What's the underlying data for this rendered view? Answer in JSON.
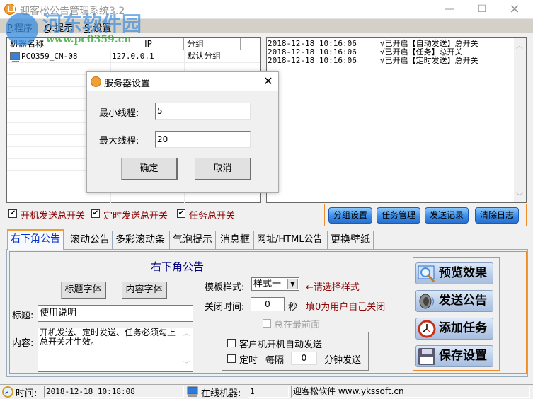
{
  "window": {
    "title": "迎客松公告管理系统3.2",
    "minimize": "—",
    "maximize": "☐",
    "close": "✕"
  },
  "menu": [
    {
      "key": "P",
      "label": ".程序"
    },
    {
      "key": "Q",
      "label": ".提示"
    },
    {
      "key": "S",
      "label": ".设置"
    }
  ],
  "watermark": {
    "text": "河东软件园",
    "url": "www.pc0359.cn"
  },
  "machine_table": {
    "columns": [
      "机器名称",
      "IP",
      "分组",
      ""
    ],
    "rows": [
      {
        "name": "PC0359_CN-08",
        "ip": "127.0.0.1",
        "group": "默认分组",
        "icon": "computer-icon"
      }
    ]
  },
  "log": [
    {
      "time": "2018-12-18 10:16:06",
      "msg": "√已开启【自动发送】总开关"
    },
    {
      "time": "2018-12-18 10:16:06",
      "msg": "√已开启【任务】总开关"
    },
    {
      "time": "2018-12-18 10:16:06",
      "msg": "√已开启【定时发送】总开关"
    }
  ],
  "dialog": {
    "title": "服务器设置",
    "close": "✕",
    "min_label": "最小线程:",
    "min_value": "5",
    "max_label": "最大线程:",
    "max_value": "20",
    "ok": "确定",
    "cancel": "取消"
  },
  "switches": [
    {
      "label": "开机发送总开关",
      "checked": true
    },
    {
      "label": "定时发送总开关",
      "checked": true
    },
    {
      "label": "任务总开关",
      "checked": true
    }
  ],
  "action_buttons": [
    "分组设置",
    "任务管理",
    "发送记录",
    "清除日志"
  ],
  "tabs": [
    {
      "label": "右下角公告",
      "active": true
    },
    {
      "label": "滚动公告"
    },
    {
      "label": "多彩滚动条"
    },
    {
      "label": "气泡提示"
    },
    {
      "label": "消息框"
    },
    {
      "label": "网址/HTML公告"
    },
    {
      "label": "更换壁纸"
    }
  ],
  "panel": {
    "heading": "右下角公告",
    "title_font_btn": "标题字体",
    "content_font_btn": "内容字体",
    "title_label": "标题:",
    "title_value": "使用说明",
    "content_label": "内容:",
    "content_value": "开机发送、定时发送、任务必须勾上总开关才生效。",
    "template_label": "模板样式:",
    "template_value": "样式一",
    "template_hint": "←请选择样式",
    "close_time_label": "关闭时间:",
    "close_time_value": "0",
    "close_time_unit": "秒",
    "close_time_hint": "填0为用户自己关闭",
    "always_top": {
      "label": "总在最前面",
      "checked": false,
      "disabled": true
    },
    "auto_send": {
      "label": "客户机开机自动发送",
      "checked": false
    },
    "timed": {
      "label": "定时",
      "checked": false
    },
    "every_label": "每隔",
    "interval_value": "0",
    "interval_unit": "分钟发送"
  },
  "big_buttons": [
    {
      "label": "预览效果",
      "icon": "magnifier-icon"
    },
    {
      "label": "发送公告",
      "icon": "speaker-icon"
    },
    {
      "label": "添加任务",
      "icon": "clock-icon"
    },
    {
      "label": "保存设置",
      "icon": "floppy-disk-icon"
    }
  ],
  "status": {
    "time_label": "时间:",
    "time_value": "2018-12-18 10:18:08",
    "online_label": "在线机器:",
    "online_value": "1",
    "company": "迎客松软件 www.ykssoft.cn"
  },
  "colors": {
    "accent_orange": "#f08c28",
    "dark_red": "#8b0000",
    "tab_blue": "#0033cc",
    "heading_navy": "#000080"
  }
}
